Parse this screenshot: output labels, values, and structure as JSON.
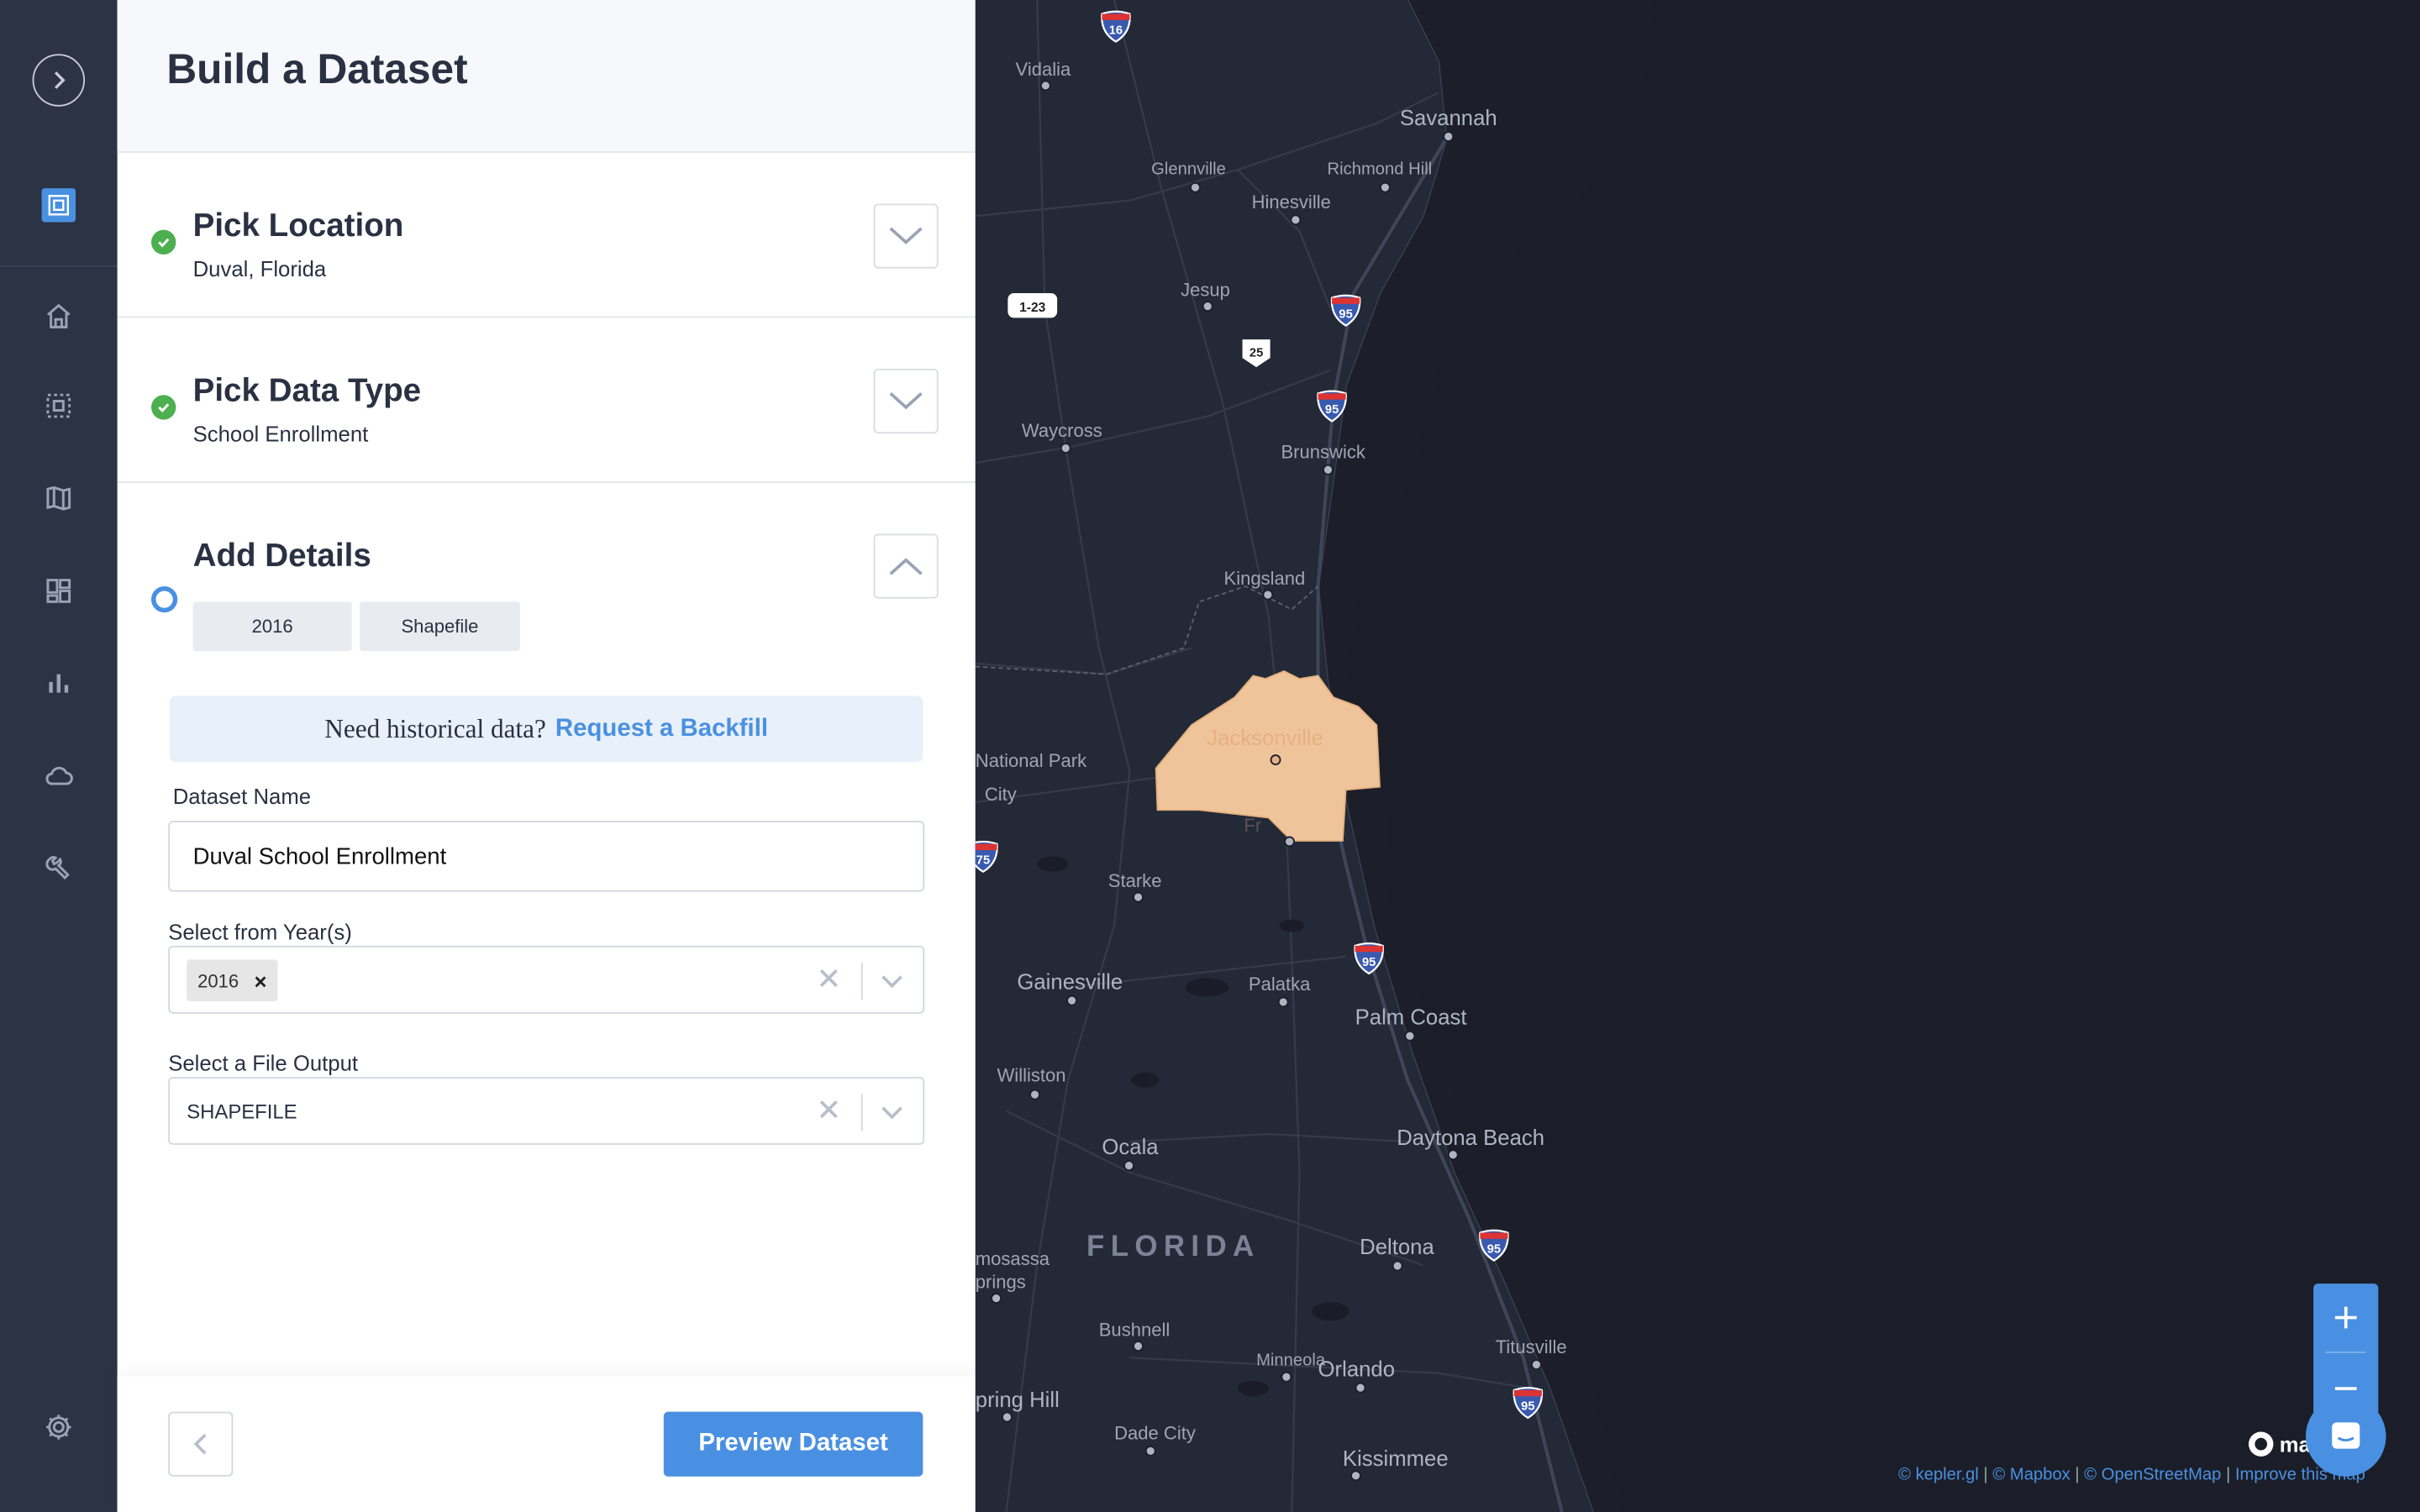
{
  "panel": {
    "title": "Build a Dataset",
    "steps": [
      {
        "title": "Pick Location",
        "subtitle": "Duval, Florida",
        "status": "complete"
      },
      {
        "title": "Pick Data Type",
        "subtitle": "School Enrollment",
        "status": "complete"
      },
      {
        "title": "Add Details",
        "status": "active",
        "chips": [
          "2016",
          "Shapefile"
        ]
      }
    ],
    "backfill": {
      "question": "Need historical data?",
      "link": "Request a Backfill"
    },
    "dataset_name": {
      "label": "Dataset Name",
      "value": "Duval School Enrollment"
    },
    "years": {
      "label": "Select from Year(s)",
      "selected": [
        "2016"
      ]
    },
    "file_output": {
      "label": "Select a File Output",
      "value": "SHAPEFILE"
    },
    "footer": {
      "preview_label": "Preview Dataset"
    }
  },
  "map": {
    "cities": [
      "Vidalia",
      "Savannah",
      "Glennville",
      "Richmond Hill",
      "Hinesville",
      "Jesup",
      "Waycross",
      "Brunswick",
      "Kingsland",
      "Jacksonville",
      "National Park",
      "City",
      "Starke",
      "Gainesville",
      "Palatka",
      "Palm Coast",
      "Williston",
      "Ocala",
      "Daytona Beach",
      "Deltona",
      "mosassa",
      "prings",
      "Bushnell",
      "Minneola",
      "Orlando",
      "Titusville",
      "pring Hill",
      "Dade City",
      "Kissimmee",
      "Fr"
    ],
    "state_label": "FLORIDA",
    "highway_shields": [
      "16",
      "1-23",
      "25",
      "95",
      "95",
      "95",
      "95",
      "95",
      "75"
    ],
    "highlight_color": "#f0c49a",
    "attribution": [
      "© kepler.gl",
      "© Mapbox",
      "© OpenStreetMap",
      "Improve this map"
    ],
    "logo_text": "ma"
  },
  "rail": {
    "icons": [
      "expand-icon",
      "kepler-logo-icon",
      "home-icon",
      "selection-icon",
      "map-icon",
      "dashboard-icon",
      "bar-chart-icon",
      "cloud-icon",
      "wrench-icon",
      "settings-icon"
    ]
  },
  "colors": {
    "accent": "#4a90e2",
    "success": "#4caf50",
    "rail": "#2c3344",
    "map_bg": "#1c1f2a"
  }
}
